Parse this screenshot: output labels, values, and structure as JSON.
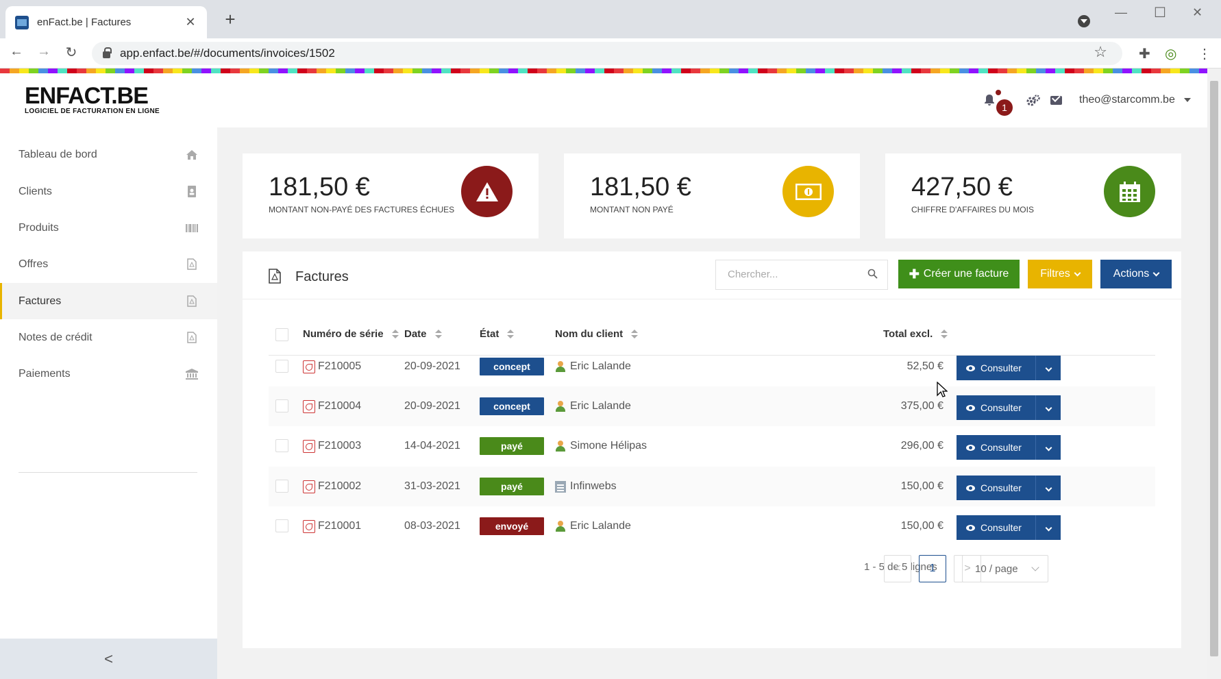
{
  "browser": {
    "tab_title": "enFact.be | Factures",
    "url": "app.enfact.be/#/documents/invoices/1502"
  },
  "header": {
    "logo_main": "ENFACT.BE",
    "logo_sub": "LOGICIEL DE FACTURATION EN LIGNE",
    "notification_count": "1",
    "user_email": "theo@starcomm.be"
  },
  "sidebar": {
    "items": [
      {
        "label": "Tableau de bord",
        "icon": "home-icon"
      },
      {
        "label": "Clients",
        "icon": "address-book-icon"
      },
      {
        "label": "Produits",
        "icon": "barcode-icon"
      },
      {
        "label": "Offres",
        "icon": "file-pdf-icon"
      },
      {
        "label": "Factures",
        "icon": "file-pdf-icon",
        "active": true
      },
      {
        "label": "Notes de crédit",
        "icon": "file-pdf-icon"
      },
      {
        "label": "Paiements",
        "icon": "bank-icon"
      }
    ],
    "collapse": "<"
  },
  "stats": [
    {
      "value": "181,50 €",
      "label": "MONTANT NON-PAYÉ DES FACTURES ÉCHUES",
      "color": "#8b1a1a",
      "icon": "warning-icon"
    },
    {
      "value": "181,50 €",
      "label": "MONTANT NON PAYÉ",
      "color": "#e8b400",
      "icon": "money-icon"
    },
    {
      "value": "427,50 €",
      "label": "CHIFFRE D'AFFAIRES DU MOIS",
      "color": "#4a8a1a",
      "icon": "calendar-icon"
    }
  ],
  "panel": {
    "title": "Factures",
    "search_placeholder": "Chercher...",
    "create_label": "Créer une facture",
    "filter_label": "Filtres",
    "actions_label": "Actions"
  },
  "table": {
    "headers": {
      "serial": "Numéro de série",
      "date": "Date",
      "state": "État",
      "client": "Nom du client",
      "total": "Total excl."
    },
    "rows": [
      {
        "serial": "F210005",
        "date": "20-09-2021",
        "state": "concept",
        "state_color": "#1d4f8e",
        "client": "Eric Lalande",
        "client_type": "person",
        "total": "52,50 €",
        "action": "Consulter"
      },
      {
        "serial": "F210004",
        "date": "20-09-2021",
        "state": "concept",
        "state_color": "#1d4f8e",
        "client": "Eric Lalande",
        "client_type": "person",
        "total": "375,00 €",
        "action": "Consulter"
      },
      {
        "serial": "F210003",
        "date": "14-04-2021",
        "state": "payé",
        "state_color": "#4a8a1a",
        "client": "Simone Hélipas",
        "client_type": "person",
        "total": "296,00 €",
        "action": "Consulter"
      },
      {
        "serial": "F210002",
        "date": "31-03-2021",
        "state": "payé",
        "state_color": "#4a8a1a",
        "client": "Infinwebs",
        "client_type": "company",
        "total": "150,00 €",
        "action": "Consulter"
      },
      {
        "serial": "F210001",
        "date": "08-03-2021",
        "state": "envoyé",
        "state_color": "#8b1a1a",
        "client": "Eric Lalande",
        "client_type": "person",
        "total": "150,00 €",
        "action": "Consulter"
      }
    ]
  },
  "pagination": {
    "info": "1 - 5 de 5 lignes",
    "prev": "<",
    "current": "1",
    "next": ">",
    "page_size": "10 / page"
  }
}
